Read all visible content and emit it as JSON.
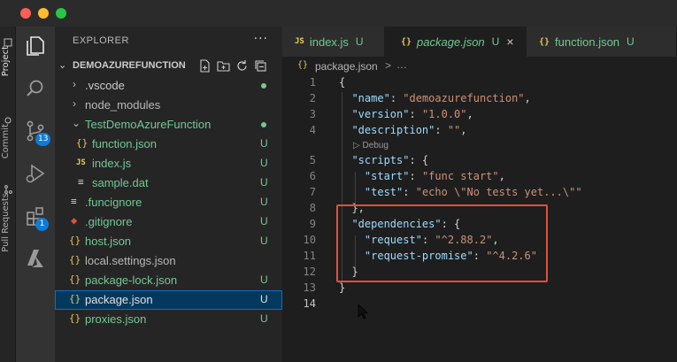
{
  "window": {
    "traffic_lights": {
      "close": "#ff5f57",
      "minimize": "#febc2e",
      "maximize": "#28c840"
    }
  },
  "tool_strip": {
    "items": [
      {
        "label": "Project",
        "active": true
      },
      {
        "label": "Commit",
        "active": false
      },
      {
        "label": "Pull Requests",
        "active": false
      }
    ]
  },
  "activity_bar": {
    "items": [
      {
        "icon": "files-icon",
        "active": true
      },
      {
        "icon": "search-icon"
      },
      {
        "icon": "source-control-icon",
        "badge": "13"
      },
      {
        "icon": "run-debug-icon"
      },
      {
        "icon": "extensions-icon",
        "badge": "1"
      },
      {
        "icon": "azure-icon"
      }
    ]
  },
  "explorer": {
    "header": "EXPLORER",
    "more": "···",
    "section_title": "DEMOAZUREFUNCTION",
    "tree": [
      {
        "name": ".vscode",
        "type": "folder",
        "status": "dot",
        "status_color": "#73c991"
      },
      {
        "name": "node_modules",
        "type": "folder",
        "status": "",
        "dim": true
      },
      {
        "name": "TestDemoAzureFunction",
        "type": "folder-open",
        "status": "dot",
        "status_color": "#73c991"
      },
      {
        "name": "function.json",
        "type": "json",
        "status": "U",
        "child": true
      },
      {
        "name": "index.js",
        "type": "js",
        "status": "U",
        "child": true
      },
      {
        "name": "sample.dat",
        "type": "file",
        "status": "U",
        "child": true
      },
      {
        "name": ".funcignore",
        "type": "file",
        "status": "U"
      },
      {
        "name": ".gitignore",
        "type": "git",
        "status": "U"
      },
      {
        "name": "host.json",
        "type": "json",
        "status": "U"
      },
      {
        "name": "local.settings.json",
        "type": "json",
        "status": "",
        "dim": true
      },
      {
        "name": "package-lock.json",
        "type": "json",
        "status": "U"
      },
      {
        "name": "package.json",
        "type": "json",
        "status": "U",
        "selected": true
      },
      {
        "name": "proxies.json",
        "type": "json",
        "status": "U"
      }
    ]
  },
  "tabs": [
    {
      "icon": "JS",
      "name": "index.js",
      "mark": "U",
      "active": false
    },
    {
      "icon": "{}",
      "name": "package.json",
      "mark": "U",
      "active": true,
      "close": "×"
    },
    {
      "icon": "{}",
      "name": "function.json",
      "mark": "U",
      "active": false
    }
  ],
  "breadcrumb": {
    "icon": "{}",
    "file": "package.json",
    "sep": ">",
    "rest": "…"
  },
  "editor": {
    "codelens": "▷ Debug",
    "lines": [
      {
        "n": "1",
        "tokens": [
          [
            "p",
            "{"
          ]
        ]
      },
      {
        "n": "2",
        "tokens": [
          [
            "p",
            "  "
          ],
          [
            "k",
            "\"name\""
          ],
          [
            "p",
            ": "
          ],
          [
            "s",
            "\"demoazurefunction\""
          ],
          [
            "p",
            ","
          ]
        ]
      },
      {
        "n": "3",
        "tokens": [
          [
            "p",
            "  "
          ],
          [
            "k",
            "\"version\""
          ],
          [
            "p",
            ": "
          ],
          [
            "s",
            "\"1.0.0\""
          ],
          [
            "p",
            ","
          ]
        ]
      },
      {
        "n": "4",
        "tokens": [
          [
            "p",
            "  "
          ],
          [
            "k",
            "\"description\""
          ],
          [
            "p",
            ": "
          ],
          [
            "s",
            "\"\""
          ],
          [
            "p",
            ","
          ]
        ]
      },
      {
        "n": "5",
        "tokens": [
          [
            "p",
            "  "
          ],
          [
            "k",
            "\"scripts\""
          ],
          [
            "p",
            ": {"
          ]
        ]
      },
      {
        "n": "6",
        "tokens": [
          [
            "p",
            "    "
          ],
          [
            "k",
            "\"start\""
          ],
          [
            "p",
            ": "
          ],
          [
            "s",
            "\"func start\""
          ],
          [
            "p",
            ","
          ]
        ]
      },
      {
        "n": "7",
        "tokens": [
          [
            "p",
            "    "
          ],
          [
            "k",
            "\"test\""
          ],
          [
            "p",
            ": "
          ],
          [
            "s",
            "\"echo \\\"No tests yet...\\\"\""
          ]
        ]
      },
      {
        "n": "8",
        "tokens": [
          [
            "p",
            "  },"
          ]
        ]
      },
      {
        "n": "9",
        "tokens": [
          [
            "p",
            "  "
          ],
          [
            "k",
            "\"dependencies\""
          ],
          [
            "p",
            ": {"
          ]
        ]
      },
      {
        "n": "10",
        "tokens": [
          [
            "p",
            "    "
          ],
          [
            "k",
            "\"request\""
          ],
          [
            "p",
            ": "
          ],
          [
            "s",
            "\"^2.88.2\""
          ],
          [
            "p",
            ","
          ]
        ]
      },
      {
        "n": "11",
        "tokens": [
          [
            "p",
            "    "
          ],
          [
            "k",
            "\"request-promise\""
          ],
          [
            "p",
            ": "
          ],
          [
            "s",
            "\"^4.2.6\""
          ]
        ]
      },
      {
        "n": "12",
        "tokens": [
          [
            "p",
            "  }"
          ]
        ]
      },
      {
        "n": "13",
        "tokens": [
          [
            "p",
            "}"
          ]
        ]
      },
      {
        "n": "14",
        "tokens": []
      }
    ],
    "highlight_color": "#e0513a"
  }
}
